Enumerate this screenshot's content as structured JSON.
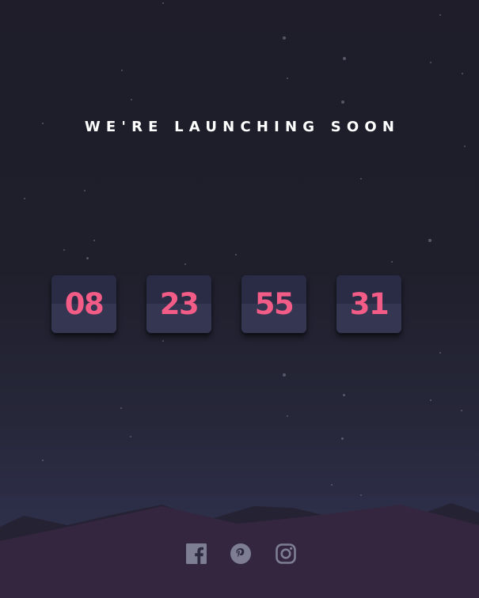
{
  "header": {
    "title": "WE'RE LAUNCHING SOON"
  },
  "countdown": {
    "days": "08",
    "hours": "23",
    "minutes": "55",
    "seconds": "31"
  },
  "social": {
    "icons": [
      "facebook-icon",
      "pinterest-icon",
      "instagram-icon"
    ]
  },
  "colors": {
    "accent": "#f35c86",
    "card_top": "#2a2b44",
    "card_bottom": "#353651",
    "hills_front": "#34263e",
    "hills_back": "#252233",
    "icon": "#7d7e94"
  }
}
